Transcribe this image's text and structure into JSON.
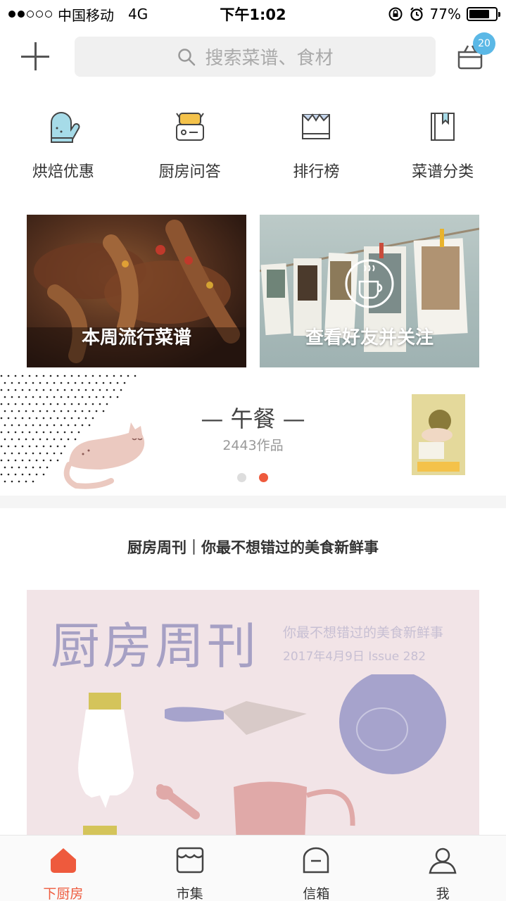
{
  "status_bar": {
    "carrier": "中国移动",
    "network": "4G",
    "time": "下午1:02",
    "battery": "77%",
    "battery_level": 0.77
  },
  "header": {
    "search_placeholder": "搜索菜谱、食材",
    "cart_badge": "20"
  },
  "quick_nav": [
    {
      "label": "烘焙优惠",
      "icon": "oven-mitt-icon"
    },
    {
      "label": "厨房问答",
      "icon": "toaster-icon"
    },
    {
      "label": "排行榜",
      "icon": "crown-box-icon"
    },
    {
      "label": "菜谱分类",
      "icon": "bookmark-book-icon"
    }
  ],
  "banners": [
    {
      "title": "本周流行菜谱"
    },
    {
      "title": "查看好友并关注"
    }
  ],
  "meal": {
    "title": "— 午餐 —",
    "count": "2443作品",
    "active_dot": 1
  },
  "weekly": {
    "section_title": "厨房周刊｜你最不想错过的美食新鲜事",
    "magazine_title": "厨房周刊",
    "magazine_subtitle": "你最不想错过的美食新鲜事",
    "magazine_issue": "2017年4月9日  Issue 282"
  },
  "tabs": [
    {
      "label": "下厨房",
      "icon": "house-icon",
      "active": true
    },
    {
      "label": "市集",
      "icon": "market-icon",
      "active": false
    },
    {
      "label": "信箱",
      "icon": "mailbox-icon",
      "active": false
    },
    {
      "label": "我",
      "icon": "profile-icon",
      "active": false
    }
  ],
  "colors": {
    "accent": "#ee5a3d",
    "badge": "#5bb8e6",
    "mitt": "#a6dbe8",
    "toaster": "#f4c24a"
  }
}
